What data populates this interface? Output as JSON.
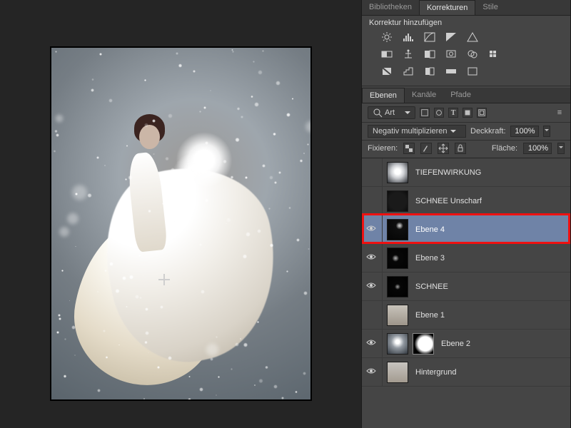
{
  "panels": {
    "tabs_top": [
      "Bibliotheken",
      "Korrekturen",
      "Stile"
    ],
    "tabs_top_active": 1,
    "adjust_title": "Korrektur hinzufügen",
    "layers_tabs": [
      "Ebenen",
      "Kanäle",
      "Pfade"
    ],
    "layers_tabs_active": 0
  },
  "layer_options": {
    "search_mode": "Art",
    "blend_mode": "Negativ multiplizieren",
    "opacity_label": "Deckkraft:",
    "opacity_value": "100%",
    "lock_label": "Fixieren:",
    "fill_label": "Fläche:",
    "fill_value": "100%"
  },
  "layers": [
    {
      "name": "TIEFENWIRKUNG",
      "visible": false,
      "selected": false,
      "thumb": "radial-gradient(circle at 50% 45%,#fff 0 18%,#caccd0 45%,#2b2e33 100%)"
    },
    {
      "name": "SCHNEE Unscharf",
      "visible": false,
      "selected": false,
      "thumb": "radial-gradient(circle,#1a1a1a 0 60%,#0b0b0b 100%),radial-gradient(circle at 30% 30%,#aaa 0 3%,transparent 4%)"
    },
    {
      "name": "Ebene 4",
      "visible": true,
      "selected": true,
      "thumb": "radial-gradient(circle at 60% 30%,#bcbcbc 0 4%,#0f0f0f 20%,#050505 100%)"
    },
    {
      "name": "Ebene 3",
      "visible": true,
      "selected": false,
      "thumb": "radial-gradient(circle at 40% 50%,#9a9a9a 0 4%,#070707 22%,#020202 100%)"
    },
    {
      "name": "SCHNEE",
      "visible": true,
      "selected": false,
      "thumb": "radial-gradient(circle at 50% 50%,#8a8a8a 0 3%,#060606 20%,#010101 100%)"
    },
    {
      "name": "Ebene 1",
      "visible": false,
      "selected": false,
      "thumb": "linear-gradient(180deg,#c8c3ba,#9d958a)"
    },
    {
      "name": "Ebene 2",
      "visible": true,
      "selected": false,
      "mask": true,
      "thumb": "radial-gradient(circle at 50% 40%,#fff 0 12%,#9198a0 40%,#30363d 100%)"
    },
    {
      "name": "Hintergrund",
      "visible": true,
      "selected": false,
      "locked": true,
      "thumb": "linear-gradient(180deg,#c7c4bf,#a39b90)"
    }
  ],
  "highlight_layer_index": 2
}
